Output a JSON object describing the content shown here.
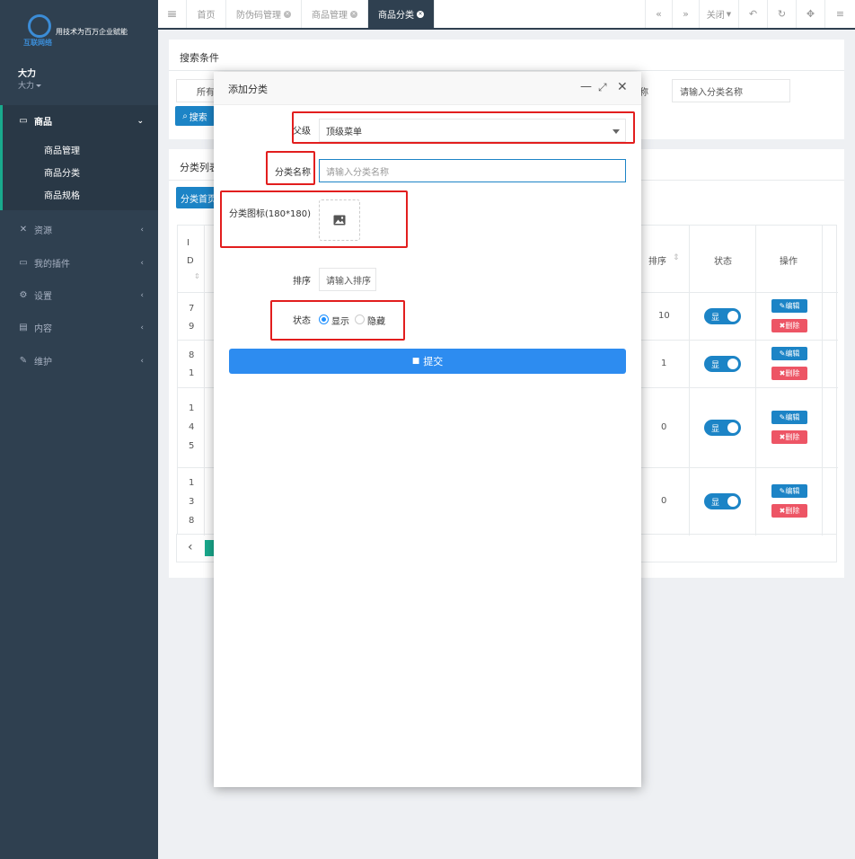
{
  "sidebar": {
    "logo_brand": "互联网络",
    "logo_slogan": "用技术为百万企业赋能",
    "user_name": "大力",
    "user_role": "大力",
    "items": [
      {
        "label": "商品",
        "icon": "laptop-icon",
        "open": true
      },
      {
        "label": "资源",
        "icon": "resource-icon"
      },
      {
        "label": "我的插件",
        "icon": "plugin-icon"
      },
      {
        "label": "设置",
        "icon": "gear-icon"
      },
      {
        "label": "内容",
        "icon": "book-icon"
      },
      {
        "label": "维护",
        "icon": "wrench-icon"
      }
    ],
    "sub_items": [
      "商品管理",
      "商品分类",
      "商品规格"
    ]
  },
  "tabs": {
    "menu_icon": "≡",
    "items": [
      {
        "label": "首页"
      },
      {
        "label": "防伪码管理"
      },
      {
        "label": "商品管理"
      },
      {
        "label": "商品分类",
        "active": true
      }
    ],
    "close_label": "关闭"
  },
  "search_panel": {
    "title": "搜索条件",
    "select_text": "所有",
    "name_label_tail": "称",
    "name_placeholder": "请输入分类名称",
    "search_button": "搜索"
  },
  "list_panel": {
    "title": "分类列表",
    "home_button": "分类首页",
    "columns": {
      "id": "I D",
      "sort": "排序",
      "status": "状态",
      "actions": "操作"
    },
    "rows": [
      {
        "id": [
          "7",
          "9"
        ],
        "sort": "10",
        "status": "显"
      },
      {
        "id": [
          "8",
          "1"
        ],
        "sort": "1",
        "status": "显"
      },
      {
        "id": [
          "1",
          "4",
          "5"
        ],
        "sort": "0",
        "status": "显"
      },
      {
        "id": [
          "1",
          "3",
          "8"
        ],
        "sort": "0",
        "status": "显"
      }
    ],
    "edit_label": "编辑",
    "delete_label": "删除",
    "prev_icon": "‹"
  },
  "modal": {
    "title": "添加分类",
    "parent_label": "父级",
    "parent_value": "顶级菜单",
    "name_label": "分类名称",
    "name_placeholder": "请输入分类名称",
    "icon_label": "分类图标(180*180)",
    "sort_label": "排序",
    "sort_placeholder": "请输入排序",
    "status_label": "状态",
    "status_options": [
      "显示",
      "隐藏"
    ],
    "status_selected": "显示",
    "submit_label": "提交"
  },
  "colors": {
    "sidebar": "#2f4050",
    "accent": "#1c84c6",
    "submit": "#2d8cf0",
    "danger": "#ed5565",
    "highlight": "#e21e1e"
  }
}
